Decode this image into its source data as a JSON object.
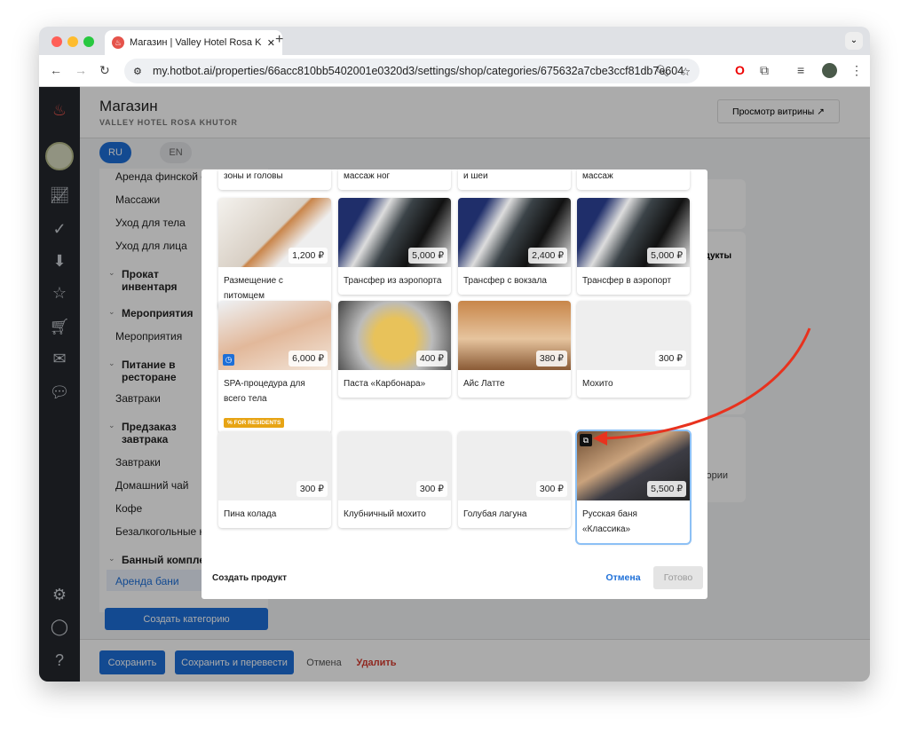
{
  "browser": {
    "tab_title": "Магазин | Valley Hotel Rosa K",
    "url": "my.hotbot.ai/properties/66acc810bb5402001e0320d3/settings/shop/categories/675632a7cbe3ccf81db7e604"
  },
  "header": {
    "title": "Магазин",
    "subtitle": "VALLEY HOTEL ROSA KHUTOR",
    "storefront_button": "Просмотр витрины ↗"
  },
  "languages": [
    "RU",
    "EN"
  ],
  "categories": [
    {
      "label": "Аренда финской с",
      "bold": false
    },
    {
      "label": "Массажи",
      "bold": false
    },
    {
      "label": "Уход для тела",
      "bold": false
    },
    {
      "label": "Уход для лица",
      "bold": false
    },
    {
      "label": "Прокат инвентаря",
      "bold": true
    },
    {
      "label": "Мероприятия",
      "bold": true
    },
    {
      "label": "Мероприятия",
      "bold": false
    },
    {
      "label": "Питание в ресторане",
      "bold": true
    },
    {
      "label": "Завтраки",
      "bold": false
    },
    {
      "label": "Предзаказ завтрака",
      "bold": true
    },
    {
      "label": "Завтраки",
      "bold": false
    },
    {
      "label": "Домашний чай",
      "bold": false
    },
    {
      "label": "Кофе",
      "bold": false
    },
    {
      "label": "Безалкогольные н",
      "bold": false
    },
    {
      "label": "Банный комплек",
      "bold": true
    },
    {
      "label": "Аренда бани",
      "bold": false,
      "active": true
    }
  ],
  "create_category": "Создать категорию",
  "bottom": {
    "save": "Сохранить",
    "save_translate": "Сохранить и перевести",
    "cancel": "Отмена",
    "delete": "Удалить"
  },
  "bg_right": {
    "products": "дукты",
    "categories": "ории"
  },
  "modal": {
    "partial_row": [
      "зоны и головы",
      "массаж ног",
      "и шеи",
      "массаж"
    ],
    "products": [
      {
        "name": "Размещение с питомцем",
        "price": "1,200 ₽"
      },
      {
        "name": "Трансфер из аэропорта",
        "price": "5,000 ₽"
      },
      {
        "name": "Трансфер с вокзала",
        "price": "2,400 ₽"
      },
      {
        "name": "Трансфер в аэропорт",
        "price": "5,000 ₽"
      },
      {
        "name": "SPA-процедура для всего тела",
        "price": "6,000 ₽",
        "badge": "FOR RESIDENTS"
      },
      {
        "name": "Паста «Карбонара»",
        "price": "400 ₽"
      },
      {
        "name": "Айс Латте",
        "price": "380 ₽"
      },
      {
        "name": "Мохито",
        "price": "300 ₽"
      },
      {
        "name": "Пина колада",
        "price": "300 ₽"
      },
      {
        "name": "Клубничный мохито",
        "price": "300 ₽"
      },
      {
        "name": "Голубая лагуна",
        "price": "300 ₽"
      },
      {
        "name": "Русская баня «Классика»",
        "price": "5,500 ₽",
        "selected": true
      }
    ],
    "create_product": "Создать продукт",
    "cancel": "Отмена",
    "done": "Готово"
  },
  "colors": {
    "accent": "#1d6fd8",
    "danger": "#d63b2f",
    "arrow": "#e8321e"
  }
}
